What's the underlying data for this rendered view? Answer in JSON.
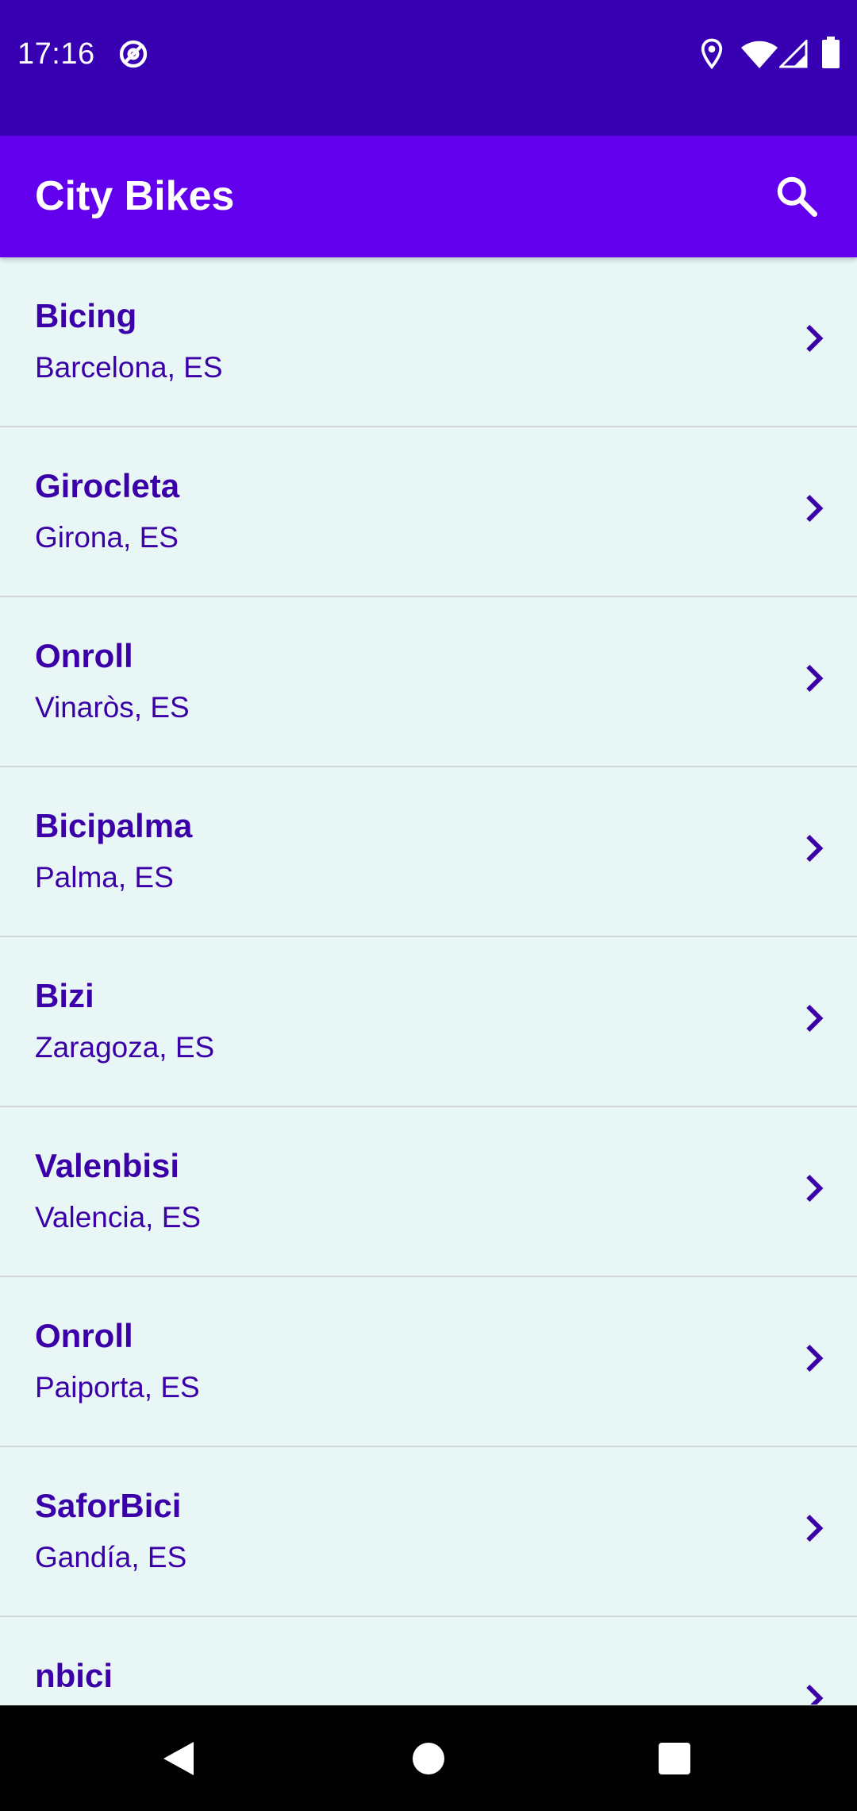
{
  "status_bar": {
    "time": "17:16",
    "icons": [
      "at-sign-icon",
      "location-pin-icon",
      "wifi-icon",
      "cell-signal-icon",
      "battery-icon"
    ]
  },
  "app_bar": {
    "title": "City Bikes",
    "search_icon": "search-icon"
  },
  "networks": [
    {
      "name": "Bicing",
      "location": "Barcelona, ES"
    },
    {
      "name": "Girocleta",
      "location": "Girona, ES"
    },
    {
      "name": "Onroll",
      "location": "Vinaròs, ES"
    },
    {
      "name": "Bicipalma",
      "location": "Palma, ES"
    },
    {
      "name": "Bizi",
      "location": "Zaragoza, ES"
    },
    {
      "name": "Valenbisi",
      "location": "Valencia, ES"
    },
    {
      "name": "Onroll",
      "location": "Paiporta, ES"
    },
    {
      "name": "SaforBici",
      "location": "Gandía, ES"
    },
    {
      "name": "nbici",
      "location": ""
    }
  ],
  "nav_bar": {
    "icons": [
      "back-icon",
      "home-icon",
      "recents-icon"
    ]
  },
  "colors": {
    "status_bar": "#3700B3",
    "app_bar": "#6200EE",
    "list_background": "#E8F7F5",
    "item_text": "#3C00A8",
    "divider": "#D2D8D6"
  }
}
